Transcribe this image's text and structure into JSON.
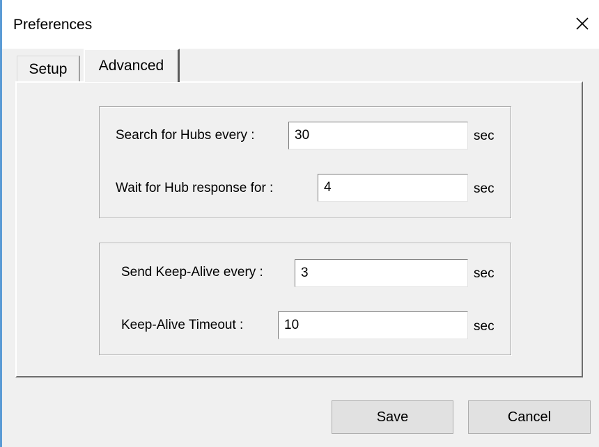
{
  "window": {
    "title": "Preferences"
  },
  "tabs": [
    {
      "label": "Setup",
      "selected": false
    },
    {
      "label": "Advanced",
      "selected": true
    }
  ],
  "hub_discovery": {
    "search_label": "Search for Hubs every :",
    "search_value": "30",
    "search_unit": "sec",
    "wait_label": "Wait for Hub response for :",
    "wait_value": "4",
    "wait_unit": "sec"
  },
  "keep_alive": {
    "interval_label": "Send Keep-Alive every :",
    "interval_value": "3",
    "interval_unit": "sec",
    "timeout_label": "Keep-Alive Timeout :",
    "timeout_value": "10",
    "timeout_unit": "sec"
  },
  "buttons": {
    "save_label": "Save",
    "cancel_label": "Cancel"
  },
  "icons": {
    "close": "close-icon"
  },
  "colors": {
    "window_background": "#f0f0f0",
    "titlebar_background": "#ffffff",
    "window_accent": "#5b9bd5",
    "button_face": "#e1e1e1"
  }
}
